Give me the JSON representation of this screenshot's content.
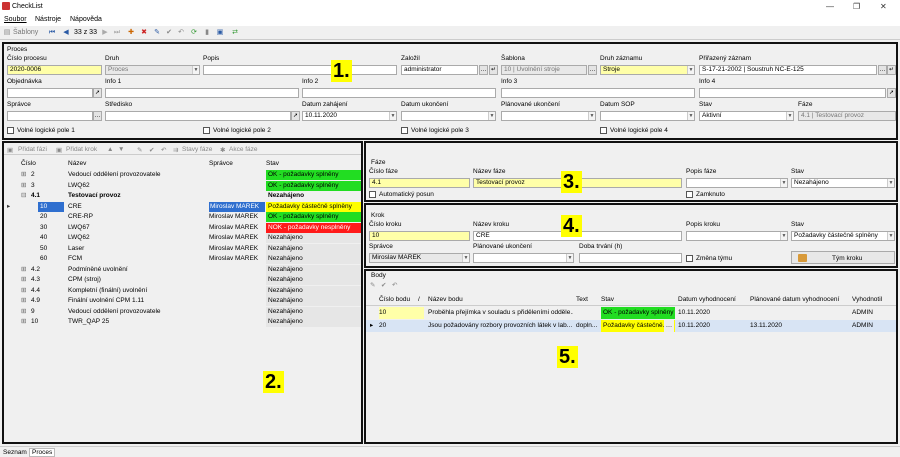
{
  "app": {
    "title": "CheckList"
  },
  "menu": [
    "Soubor",
    "Nástroje",
    "Nápověda"
  ],
  "toolbar": {
    "templates_label": "Šablony",
    "record_counter": "33 z 33"
  },
  "badges": {
    "b1": "1.",
    "b2": "2.",
    "b3": "3.",
    "b4": "4.",
    "b5": "5."
  },
  "proces": {
    "section_label": "Proces",
    "cislo_label": "Číslo procesu",
    "cislo_value": "2020-0006",
    "druh_label": "Druh",
    "druh_value": "Proces",
    "popis_label": "Popis",
    "popis_value": "",
    "zalozil_label": "Založil",
    "zalozil_value": "administrator",
    "sablona_label": "Šablona",
    "sablona_value": "10 | Uvolnění stroje",
    "druh_zaznamu_label": "Druh záznamu",
    "druh_zaznamu_value": "Stroje",
    "prirazeny_label": "Přiřazený záznam",
    "prirazeny_value": "S-17-21-2002 | Soustruh NC-E-125",
    "objednavka_label": "Objednávka",
    "info1_label": "Info 1",
    "info2_label": "Info 2",
    "info3_label": "Info 3",
    "info4_label": "Info 4",
    "spravce_label": "Správce",
    "stredisko_label": "Středisko",
    "datum_zahajeni_label": "Datum zahájení",
    "datum_zahajeni_value": "10.11.2020",
    "datum_ukonceni_label": "Datum ukončení",
    "planovane_label": "Plánované ukončení",
    "datum_sop_label": "Datum SOP",
    "stav_label": "Stav",
    "stav_value": "Aktivní",
    "faze_label": "Fáze",
    "faze_value": "4.1 | Testovací provoz",
    "vlp1": "Volné logické pole 1",
    "vlp2": "Volné logické pole 2",
    "vlp3": "Volné logické pole 3",
    "vlp4": "Volné logické pole 4"
  },
  "tree": {
    "buttons": {
      "pridat_fazi": "Přidat fázi",
      "pridat_krok": "Přidat krok",
      "stavy_faze": "Stavy fáze",
      "akce_faze": "Akce fáze"
    },
    "headers": {
      "cislo": "Číslo",
      "nazev": "Název",
      "spravce": "Správce",
      "stav": "Stav"
    },
    "rows": [
      {
        "cislo": "2",
        "nazev": "Vedoucí oddělení provozovatele",
        "spravce": "",
        "stav": "OK - požadavky splněny"
      },
      {
        "cislo": "3",
        "nazev": "LWQ62",
        "spravce": "",
        "stav": "OK - požadavky splněny"
      },
      {
        "cislo": "4.1",
        "nazev": "Testovací provoz",
        "spravce": "",
        "stav": "Nezahájeno"
      },
      {
        "cislo": "10",
        "nazev": "CRE",
        "spravce": "Miroslav MAREK",
        "stav": "Požadavky částečně splněny"
      },
      {
        "cislo": "20",
        "nazev": "CRE-RP",
        "spravce": "Miroslav MAREK",
        "stav": "OK - požadavky splněny"
      },
      {
        "cislo": "30",
        "nazev": "LWQ67",
        "spravce": "Miroslav MAREK",
        "stav": "NOK - požadavky nesplněny"
      },
      {
        "cislo": "40",
        "nazev": "LWQ62",
        "spravce": "Miroslav MAREK",
        "stav": "Nezahájeno"
      },
      {
        "cislo": "50",
        "nazev": "Laser",
        "spravce": "Miroslav MAREK",
        "stav": "Nezahájeno"
      },
      {
        "cislo": "60",
        "nazev": "FCM",
        "spravce": "Miroslav MAREK",
        "stav": "Nezahájeno"
      },
      {
        "cislo": "4.2",
        "nazev": "Podmíněné uvolnění",
        "spravce": "",
        "stav": "Nezahájeno"
      },
      {
        "cislo": "4.3",
        "nazev": "CPM (stroj)",
        "spravce": "",
        "stav": "Nezahájeno"
      },
      {
        "cislo": "4.4",
        "nazev": "Kompletní (finální) uvolnění",
        "spravce": "",
        "stav": "Nezahájeno"
      },
      {
        "cislo": "4.9",
        "nazev": "Finální uvolnění CPM 1.11",
        "spravce": "",
        "stav": "Nezahájeno"
      },
      {
        "cislo": "9",
        "nazev": "Vedoucí oddělení provozovatele",
        "spravce": "",
        "stav": "Nezahájeno"
      },
      {
        "cislo": "10",
        "nazev": "TWR_QAP 25",
        "spravce": "",
        "stav": "Nezahájeno"
      }
    ]
  },
  "faze": {
    "section_label": "Fáze",
    "cislo_label": "Číslo fáze",
    "cislo_value": "4.1",
    "nazev_label": "Název fáze",
    "nazev_value": "Testovací provoz",
    "popis_label": "Popis fáze",
    "stav_label": "Stav",
    "stav_value": "Nezahájeno",
    "auto_posun": "Automatický posun",
    "zamknuto": "Zamknuto"
  },
  "krok": {
    "section_label": "Krok",
    "cislo_label": "Číslo kroku",
    "cislo_value": "10",
    "nazev_label": "Název kroku",
    "nazev_value": "CRE",
    "popis_label": "Popis kroku",
    "stav_label": "Stav",
    "stav_value": "Požadavky částečně splněny",
    "spravce_label": "Správce",
    "spravce_value": "Miroslav MAREK",
    "planovane_label": "Plánované ukončení",
    "doba_label": "Doba trvání (h)",
    "zmena_tymu": "Změna týmu",
    "tym_kroku": "Tým kroku"
  },
  "body": {
    "section_label": "Body",
    "headers": {
      "cislo": "Číslo bodu",
      "nazev": "Název bodu",
      "text": "Text",
      "stav": "Stav",
      "datum": "Datum vyhodnocení",
      "planovane": "Plánované datum vyhodnocení",
      "vyhodnotil": "Vyhodnotil"
    },
    "rows": [
      {
        "cislo": "10",
        "nazev": "Proběhla přejímka v souladu s přiděleními odděle...",
        "text": "",
        "stav": "OK - požadavky splněny",
        "datum": "10.11.2020",
        "planovane": "",
        "vyhodnotil": "ADMIN"
      },
      {
        "cislo": "20",
        "nazev": "Jsou požadovány rozbory provozních látek v lab...",
        "text": "dopln...",
        "stav": "Požadavky částečně...",
        "datum": "10.11.2020",
        "planovane": "13.11.2020",
        "vyhodnotil": "ADMIN"
      }
    ]
  },
  "status_tabs": [
    "Seznam",
    "Proces"
  ],
  "colors": {
    "ok": "#22dd22",
    "nok": "#ff1a1a",
    "partial": "#ffff00",
    "selected": "#2f6fcf"
  }
}
